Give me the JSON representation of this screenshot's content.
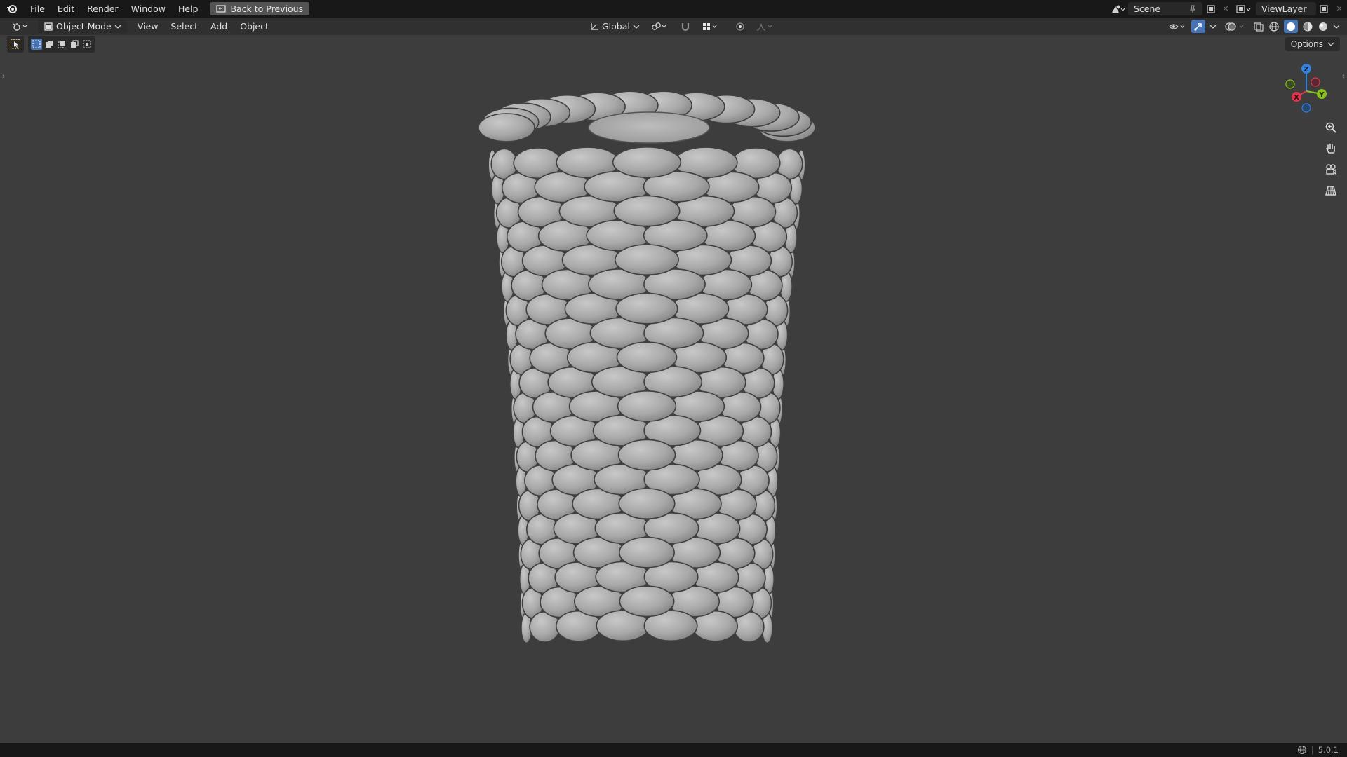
{
  "menubar": {
    "items": [
      "File",
      "Edit",
      "Render",
      "Window",
      "Help"
    ],
    "back_button": "Back to Previous",
    "scene": "Scene",
    "view_layer": "ViewLayer"
  },
  "header": {
    "mode": "Object Mode",
    "menus": [
      "View",
      "Select",
      "Add",
      "Object"
    ],
    "transform_orientation": "Global"
  },
  "viewport": {
    "options_label": "Options",
    "object": "corn-cob-mesh",
    "gizmo_axes": [
      "Z",
      "Y",
      "X"
    ]
  },
  "status": {
    "version": "5.0.1"
  },
  "colors": {
    "accent": "#4772b3",
    "axis_x": "#e0364f",
    "axis_y": "#8cc21f",
    "axis_z": "#2f83e3"
  }
}
